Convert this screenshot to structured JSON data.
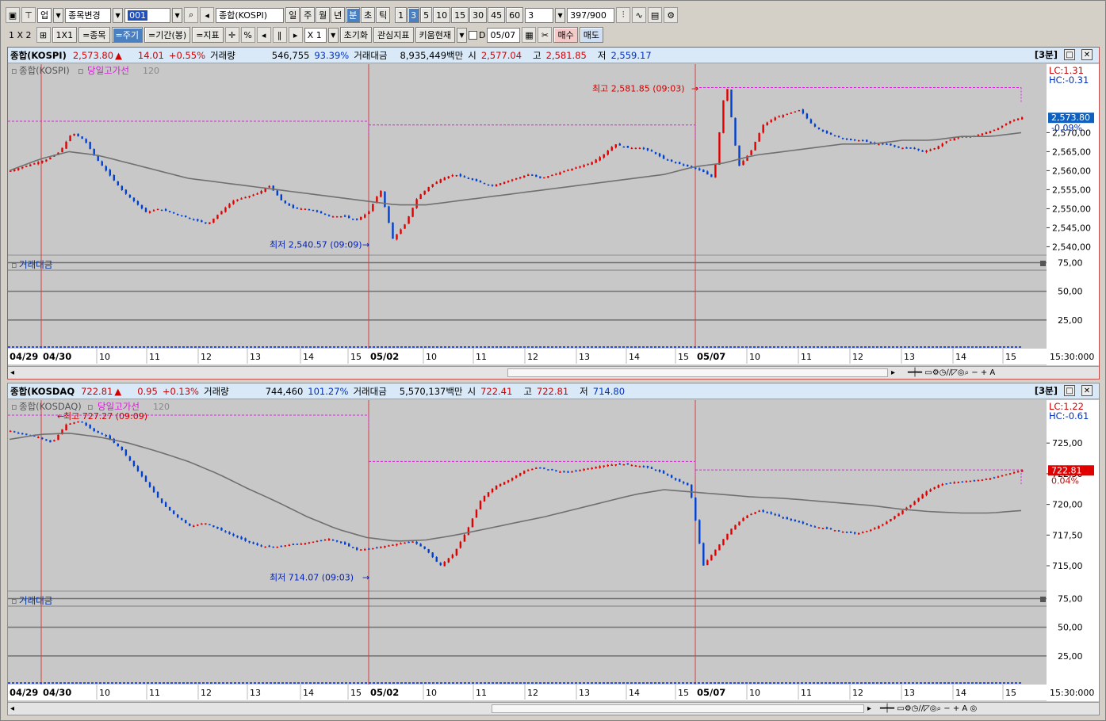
{
  "toolbar1": {
    "type_label": "업",
    "change_label": "종목변경",
    "code_value": "001",
    "name_value": "종합(KOSPI)",
    "periods": [
      "일",
      "주",
      "월",
      "년",
      "분",
      "초",
      "틱"
    ],
    "active_period": "분",
    "minutes": [
      "1",
      "3",
      "5",
      "10",
      "15",
      "30",
      "45",
      "60"
    ],
    "active_minute": "3",
    "interval_value": "3",
    "count_value": "397/900"
  },
  "toolbar2": {
    "layout_label": "1 X 2",
    "onebyone_label": "1X1",
    "stock_label": "=종목",
    "cycle_label": "=주기",
    "period_label": "=기간(봉)",
    "indicator_label": "=지표",
    "pct_label": "%",
    "x1_label": "X 1",
    "reset_label": "초기화",
    "interest_label": "관심지표",
    "kiwoom_label": "키움현재",
    "d_label": "D",
    "date_value": "05/07",
    "buy_label": "매수",
    "sell_label": "매도"
  },
  "kospi": {
    "header": {
      "name": "종합(KOSPI)",
      "price": "2,573.80",
      "arrow": "▲",
      "change": "14.01",
      "pct": "+0.55%",
      "vol_label": "거래량",
      "vol": "546,755",
      "vol_pct": "93.39%",
      "amt_label": "거래대금",
      "amt": "8,935,449백만",
      "open_label": "시",
      "open": "2,577.04",
      "high_label": "고",
      "high": "2,581.85",
      "low_label": "저",
      "low": "2,559.17",
      "interval": "[3분]"
    },
    "legend": {
      "series": "종합(KOSPI)",
      "line": "당일고가선",
      "ma": "120"
    },
    "lc": "LC:1.31",
    "hc": "HC:-0.31",
    "price_tag": "2,573.80",
    "pct_tag": "-0.09%",
    "high_note": "최고 2,581.85 (09:03)",
    "low_note": "최저 2,540.57 (09:09)",
    "sub_title": "거래대금",
    "time_axis": "15:30:000"
  },
  "kosdaq": {
    "header": {
      "name": "종합(KOSDAQ",
      "price": "722.81",
      "arrow": "▲",
      "change": "0.95",
      "pct": "+0.13%",
      "vol_label": "거래량",
      "vol": "744,460",
      "vol_pct": "101.27%",
      "amt_label": "거래대금",
      "amt": "5,570,137백만",
      "open_label": "시",
      "open": "722.41",
      "high_label": "고",
      "high": "722.81",
      "low_label": "저",
      "low": "714.80",
      "interval": "[3분]"
    },
    "legend": {
      "series": "종합(KOSDAQ)",
      "line": "당일고가선",
      "ma": "120"
    },
    "lc": "LC:1.22",
    "hc": "HC:-0.61",
    "price_tag": "722.81",
    "pct_tag": "0.04%",
    "high_note": "최고 727.27 (09:09)",
    "low_note": "최저 714.07 (09:03)",
    "sub_title": "거래대금",
    "time_axis": "15:30:000"
  },
  "colors": {
    "up": "#e00000",
    "down": "#0040d0",
    "ma": "#707070",
    "highline": "#e020e0",
    "session": "#d04040"
  },
  "chart_data": [
    {
      "type": "candlestick",
      "title": "종합(KOSPI)",
      "y_ticks": [
        2540,
        2545,
        2550,
        2555,
        2560,
        2565,
        2570
      ],
      "ylim": [
        2538,
        2588
      ],
      "x_day_labels": [
        "04/29",
        "04/30",
        "05/02",
        "05/07"
      ],
      "x_hour_labels": [
        "10",
        "11",
        "12",
        "13",
        "14",
        "15"
      ],
      "close_path": [
        2560,
        2561,
        2562,
        2563,
        2565,
        2570,
        2568,
        2563,
        2559,
        2555,
        2552,
        2549,
        2550,
        2549,
        2548,
        2547,
        2546,
        2549,
        2552,
        2553,
        2554,
        2556,
        2552,
        2550,
        2550,
        2549,
        2548,
        2548,
        2547,
        2549,
        2555,
        2542,
        2546,
        2553,
        2556,
        2558,
        2559,
        2558,
        2557,
        2556,
        2557,
        2558,
        2559,
        2558,
        2559,
        2560,
        2561,
        2562,
        2564,
        2567,
        2566,
        2566,
        2565,
        2563,
        2562,
        2561,
        2560,
        2558,
        2584,
        2561,
        2565,
        2572,
        2574,
        2575,
        2576,
        2572,
        2570,
        2569,
        2568,
        2568,
        2567,
        2567,
        2566,
        2566,
        2565,
        2566,
        2568,
        2569,
        2569,
        2570,
        2571,
        2573,
        2574
      ],
      "ma_path": [
        2560,
        2563,
        2565,
        2564,
        2562,
        2560,
        2558,
        2557,
        2556,
        2555,
        2554,
        2553,
        2552,
        2551,
        2551,
        2552,
        2553,
        2554,
        2555,
        2556,
        2557,
        2558,
        2559,
        2561,
        2562,
        2564,
        2565,
        2566,
        2567,
        2567,
        2568,
        2568,
        2569,
        2569,
        2570
      ],
      "day_high_lines": [
        2573,
        2572,
        2581.85
      ],
      "highest": 2581.85,
      "lowest": 2540.57,
      "sub_y_ticks": [
        25,
        50,
        75
      ]
    },
    {
      "type": "candlestick",
      "title": "종합(KOSDAQ)",
      "y_ticks": [
        715,
        717.5,
        720,
        722.5,
        725
      ],
      "ylim": [
        713,
        728.5
      ],
      "x_day_labels": [
        "04/29",
        "04/30",
        "05/02",
        "05/07"
      ],
      "x_hour_labels": [
        "10",
        "11",
        "12",
        "13",
        "14",
        "15"
      ],
      "close_path": [
        726,
        725.7,
        725.5,
        725,
        726.5,
        726.8,
        726,
        725.5,
        724.5,
        723,
        721.5,
        720,
        719,
        718.2,
        718.5,
        718,
        717.5,
        717,
        716.6,
        716.5,
        716.7,
        716.8,
        717,
        717.2,
        716.8,
        716.3,
        716.4,
        716.6,
        716.8,
        717,
        716.3,
        715,
        716,
        718,
        720.5,
        721.5,
        722,
        722.7,
        723,
        722.8,
        722.6,
        722.8,
        723,
        723.2,
        723.3,
        723.2,
        723,
        722.6,
        722,
        721.5,
        715,
        716.5,
        718,
        719,
        719.5,
        719.2,
        718.8,
        718.5,
        718.2,
        718,
        717.8,
        717.6,
        717.9,
        718.4,
        719.2,
        720,
        721,
        721.6,
        721.8,
        721.9,
        722,
        722.2,
        722.5,
        722.8
      ],
      "ma_path": [
        725.3,
        725.7,
        725.8,
        725.5,
        725,
        724.3,
        723.5,
        722.5,
        721.3,
        720.2,
        719,
        718,
        717.3,
        717,
        717.1,
        717.5,
        718,
        718.5,
        719,
        719.6,
        720.2,
        720.8,
        721.2,
        721,
        720.8,
        720.6,
        720.5,
        720.3,
        720.1,
        719.9,
        719.6,
        719.4,
        719.3,
        719.3,
        719.5
      ],
      "day_high_lines": [
        727.27,
        723.5,
        722.81
      ],
      "highest": 727.27,
      "lowest": 714.07,
      "sub_y_ticks": [
        25,
        50,
        75
      ]
    }
  ]
}
